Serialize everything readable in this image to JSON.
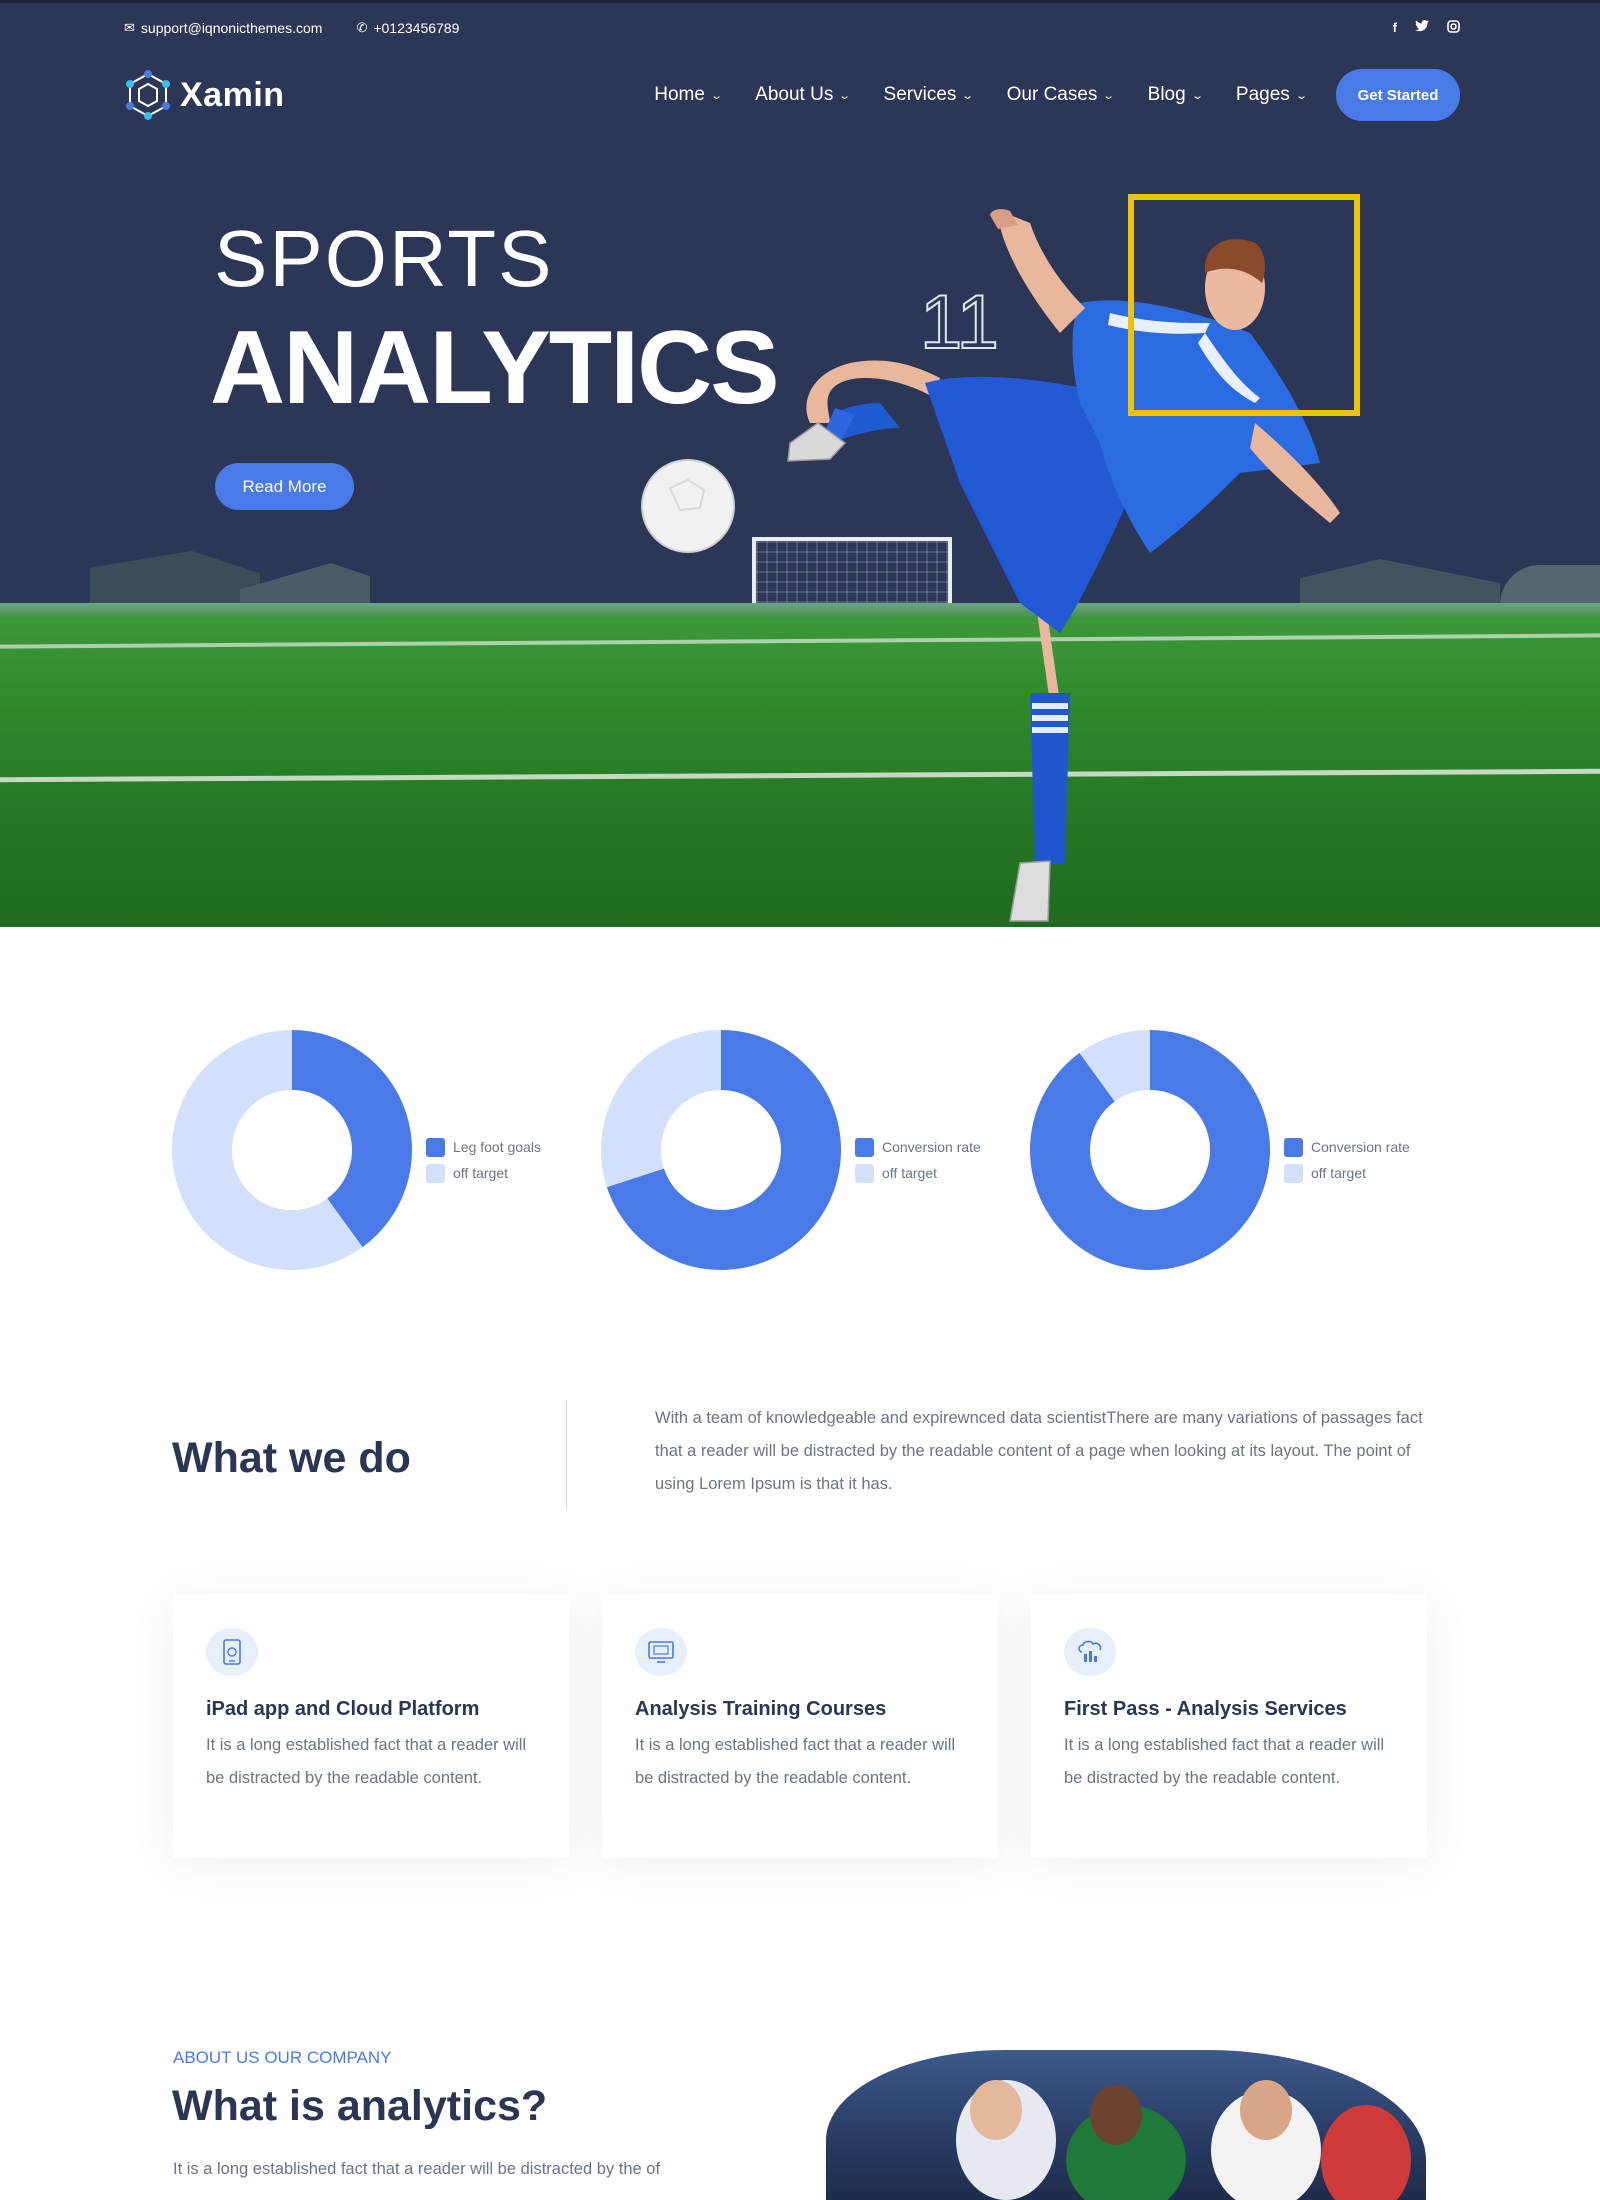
{
  "topbar": {
    "email": "support@iqnonicthemes.com",
    "phone": "+0123456789",
    "socials": [
      "facebook-icon",
      "twitter-icon",
      "instagram-icon"
    ]
  },
  "nav": {
    "logo": "Xamin",
    "items": [
      {
        "label": "Home"
      },
      {
        "label": "About Us"
      },
      {
        "label": "Services"
      },
      {
        "label": "Our Cases"
      },
      {
        "label": "Blog"
      },
      {
        "label": "Pages"
      }
    ],
    "cta": "Get Started"
  },
  "hero": {
    "line1": "SPORTS",
    "line2": "ANALYTICS",
    "button": "Read More",
    "jersey_number": "11"
  },
  "colors": {
    "primary": "#4a7ae8",
    "light": "#d3e0fb",
    "navy": "#2c3757",
    "highlight": "#f2c200"
  },
  "chart_data": [
    {
      "type": "pie",
      "categories": [
        "Leg foot goals",
        "off target"
      ],
      "values": [
        40,
        60
      ]
    },
    {
      "type": "pie",
      "categories": [
        "Conversion rate",
        "off target"
      ],
      "values": [
        70,
        30
      ]
    },
    {
      "type": "pie",
      "categories": [
        "Conversion rate",
        "off target"
      ],
      "values": [
        90,
        10
      ]
    }
  ],
  "what_we_do": {
    "title": "What we do",
    "text": "With a team of knowledgeable and expirewnced data scientistThere are many variations of passages fact that a reader will be distracted by the readable content of a page when looking at its layout. The point of using Lorem Ipsum is that it has."
  },
  "cards": [
    {
      "icon": "tablet-icon",
      "title": "iPad app and Cloud Platform",
      "text": "It is a long established fact that a reader will be distracted by the readable content."
    },
    {
      "icon": "monitor-icon",
      "title": "Analysis Training Courses",
      "text": "It is a long established fact that a reader will be distracted by the readable content."
    },
    {
      "icon": "cloud-chart-icon",
      "title": "First Pass - Analysis Services",
      "text": "It is a long established fact that a reader will be distracted by the readable content."
    }
  ],
  "about": {
    "tag": "ABOUT US OUR COMPANY",
    "title": "What is analytics?",
    "text": "It is a long established fact that a reader will be distracted by the of"
  }
}
